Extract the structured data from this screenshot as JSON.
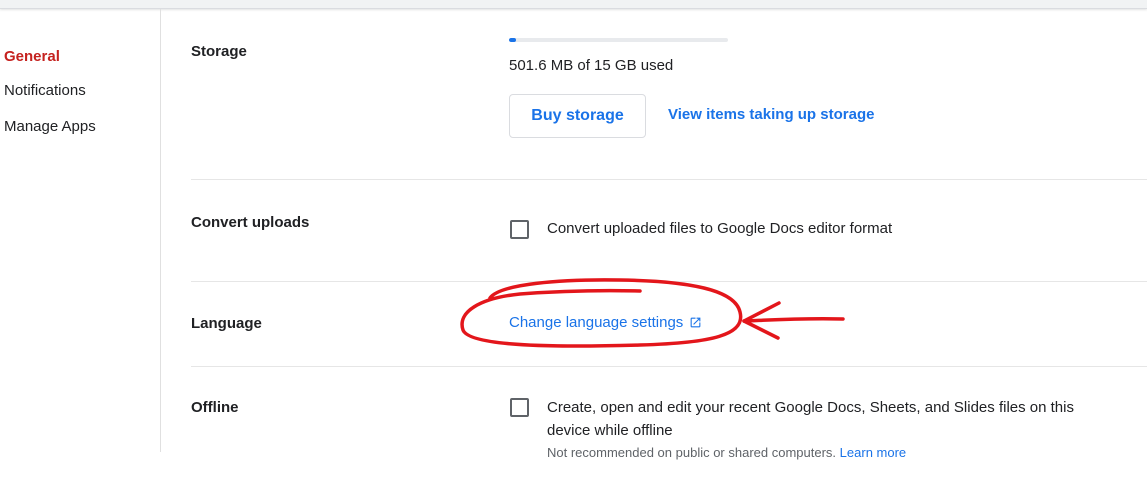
{
  "nav": {
    "items": [
      {
        "label": "General",
        "active": true
      },
      {
        "label": "Notifications",
        "active": false
      },
      {
        "label": "Manage Apps",
        "active": false
      }
    ]
  },
  "storage": {
    "label": "Storage",
    "used_fraction": 0.033,
    "usage_text": "501.6 MB of 15 GB used",
    "buy_label": "Buy storage",
    "view_label": "View items taking up storage"
  },
  "convert": {
    "label": "Convert uploads",
    "checkbox_text": "Convert uploaded files to Google Docs editor format",
    "checked": false
  },
  "language": {
    "label": "Language",
    "link_text": "Change language settings",
    "link_icon": "open-in-new-icon"
  },
  "offline": {
    "label": "Offline",
    "checkbox_text_line1": "Create, open and edit your recent Google Docs, Sheets, and Slides files on this",
    "checkbox_text_line2": "device while offline",
    "note": "Not recommended on public or shared computers.",
    "learn_more": "Learn more",
    "checked": false
  },
  "colors": {
    "accent": "#1a73e8",
    "nav_active": "#c5221f",
    "annotation": "#e3161b"
  }
}
